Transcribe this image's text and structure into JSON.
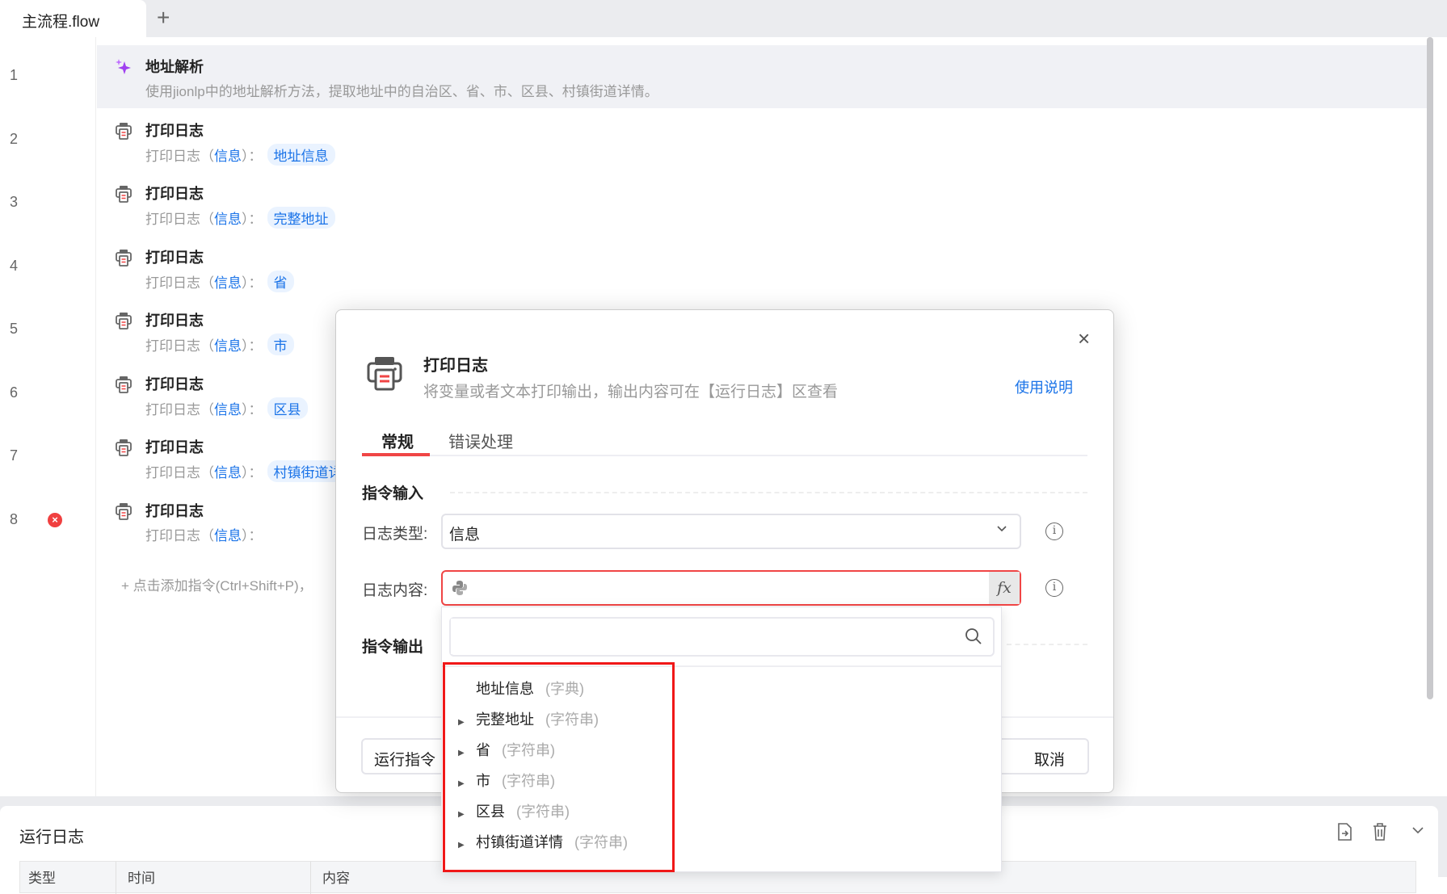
{
  "tabs": {
    "active": "主流程.flow",
    "add": "+"
  },
  "rows": [
    {
      "line": "1",
      "title": "地址解析",
      "desc": "使用jionlp中的地址解析方法，提取地址中的自治区、省、市、区县、村镇街道详情。",
      "icon": "sparkle-icon"
    },
    {
      "line": "2",
      "title": "打印日志",
      "prefix": "打印日志（",
      "type": "信息",
      "suffix": "）：",
      "var": "地址信息",
      "icon": "printer-icon"
    },
    {
      "line": "3",
      "title": "打印日志",
      "prefix": "打印日志（",
      "type": "信息",
      "suffix": "）：",
      "var": "完整地址",
      "icon": "printer-icon"
    },
    {
      "line": "4",
      "title": "打印日志",
      "prefix": "打印日志（",
      "type": "信息",
      "suffix": "）：",
      "var": "省",
      "icon": "printer-icon"
    },
    {
      "line": "5",
      "title": "打印日志",
      "prefix": "打印日志（",
      "type": "信息",
      "suffix": "）：",
      "var": "市",
      "icon": "printer-icon"
    },
    {
      "line": "6",
      "title": "打印日志",
      "prefix": "打印日志（",
      "type": "信息",
      "suffix": "）：",
      "var": "区县",
      "icon": "printer-icon"
    },
    {
      "line": "7",
      "title": "打印日志",
      "prefix": "打印日志（",
      "type": "信息",
      "suffix": "）：",
      "var": "村镇街道详情",
      "icon": "printer-icon"
    },
    {
      "line": "8",
      "title": "打印日志",
      "prefix": "打印日志（",
      "type": "信息",
      "suffix": "）：",
      "var": "",
      "icon": "printer-icon",
      "error": true
    }
  ],
  "add_command": "+ 点击添加指令(Ctrl+Shift+P)，",
  "error_mark": "×",
  "log": {
    "title": "运行日志",
    "columns": [
      "类型",
      "时间",
      "内容"
    ]
  },
  "dialog": {
    "title": "打印日志",
    "desc": "将变量或者文本打印输出，输出内容可在【运行日志】区查看",
    "help": "使用说明",
    "close": "×",
    "tabs": [
      "常规",
      "错误处理"
    ],
    "input_section": "指令输入",
    "output_section": "指令输出",
    "log_type_label": "日志类型:",
    "log_type_value": "信息",
    "log_content_label": "日志内容:",
    "log_content_value": "",
    "fx": "fx",
    "info": "i",
    "run_button": "运行指令",
    "cancel_button": "取消"
  },
  "dropdown": {
    "search_placeholder": "",
    "items": [
      {
        "name": "地址信息",
        "type": "(字典)",
        "expandable": false
      },
      {
        "name": "完整地址",
        "type": "(字符串)",
        "expandable": true
      },
      {
        "name": "省",
        "type": "(字符串)",
        "expandable": true
      },
      {
        "name": "市",
        "type": "(字符串)",
        "expandable": true
      },
      {
        "name": "区县",
        "type": "(字符串)",
        "expandable": true
      },
      {
        "name": "村镇街道详情",
        "type": "(字符串)",
        "expandable": true
      }
    ]
  },
  "colors": {
    "accent": "#1a73e8",
    "danger": "#f04545",
    "highlight": "#f01818"
  }
}
